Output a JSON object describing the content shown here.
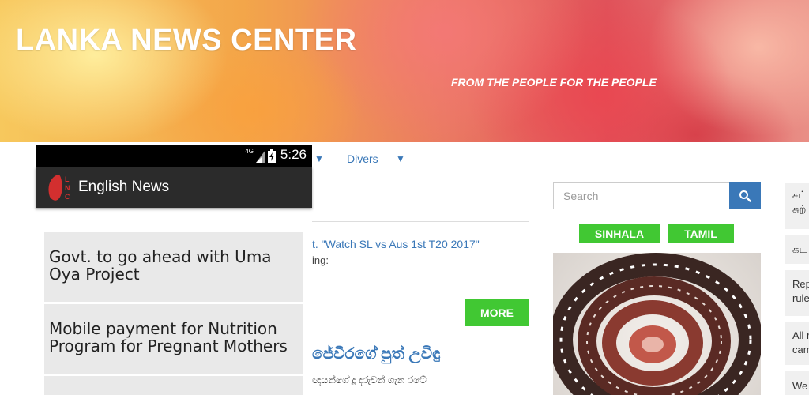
{
  "banner": {
    "title": "LANKA NEWS CENTER",
    "tagline": "FROM THE PEOPLE FOR THE PEOPLE"
  },
  "nav": {
    "divers_label": "Divers"
  },
  "article": {
    "headline_link": "t. \"Watch SL vs Aus 1st T20 2017\"",
    "snippet": "ing:",
    "more_label": "MORE",
    "sinhala_title": "ජේවීරගේ පුත් උවිඳු",
    "sinhala_snippet": "ඥයන්ගේ දූ දරුවන් ගැන රටේ"
  },
  "search": {
    "placeholder": "Search"
  },
  "languages": {
    "sinhala": "SINHALA",
    "tamil": "TAMIL"
  },
  "right_list": [
    {
      "line1": "சட்",
      "line2": "சுற்"
    },
    {
      "line1": "கட",
      "line2": ""
    },
    {
      "line1": "Rep",
      "line2": "rule"
    },
    {
      "line1": "All r",
      "line2": "cam"
    },
    {
      "line1": "We",
      "line2": ""
    }
  ],
  "phone": {
    "status_time": "5:26",
    "network_label": "4G",
    "app_title": "English News",
    "logo_letters": "LNC",
    "news_items": [
      {
        "title": "Govt. to go ahead with Uma Oya Project"
      },
      {
        "title": "Mobile payment for Nutrition Program for Pregnant Mothers"
      }
    ]
  },
  "colors": {
    "accent_green": "#41c833",
    "link_blue": "#3a78b8",
    "app_bar": "#2b2b2b",
    "card_bg": "#e9e9e9",
    "logo_red": "#d32f2f"
  }
}
